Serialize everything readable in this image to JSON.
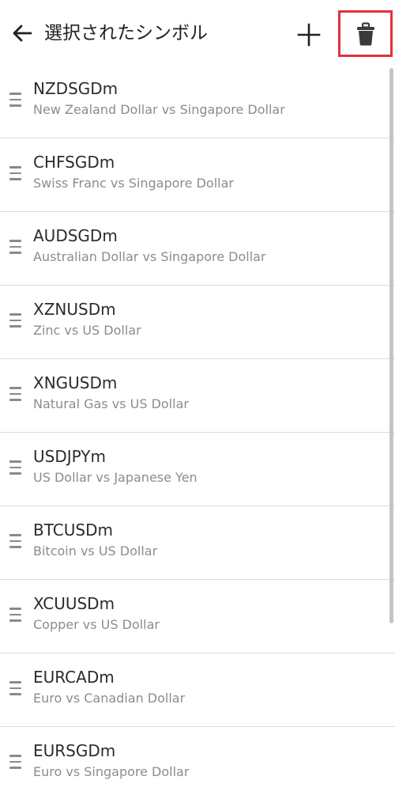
{
  "header": {
    "title": "選択されたシンボル",
    "back_icon": "arrow-left-icon",
    "add_icon": "plus-icon",
    "delete_icon": "trash-icon",
    "highlight_color": "#e0323a"
  },
  "symbols": [
    {
      "symbol": "NZDSGDm",
      "description": "New Zealand Dollar vs Singapore Dollar"
    },
    {
      "symbol": "CHFSGDm",
      "description": "Swiss Franc vs Singapore Dollar"
    },
    {
      "symbol": "AUDSGDm",
      "description": "Australian Dollar vs Singapore Dollar"
    },
    {
      "symbol": "XZNUSDm",
      "description": "Zinc vs US Dollar"
    },
    {
      "symbol": "XNGUSDm",
      "description": "Natural Gas vs US Dollar"
    },
    {
      "symbol": "USDJPYm",
      "description": "US Dollar vs Japanese Yen"
    },
    {
      "symbol": "BTCUSDm",
      "description": "Bitcoin vs US Dollar"
    },
    {
      "symbol": "XCUUSDm",
      "description": "Copper vs US Dollar"
    },
    {
      "symbol": "EURCADm",
      "description": "Euro vs Canadian Dollar"
    },
    {
      "symbol": "EURSGDm",
      "description": "Euro vs Singapore Dollar"
    }
  ]
}
